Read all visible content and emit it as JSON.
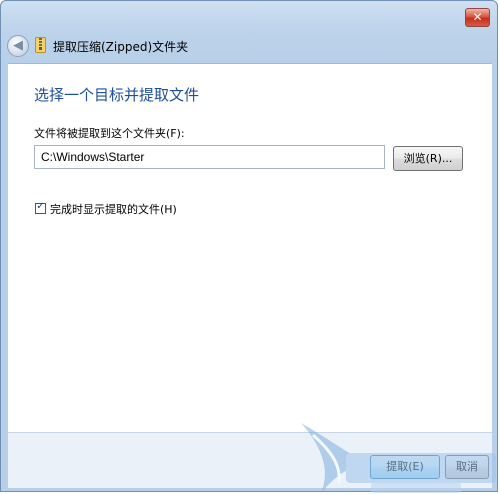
{
  "window": {
    "close_glyph": "✕",
    "title": "提取压缩(Zipped)文件夹",
    "back_glyph": "◀"
  },
  "dialog": {
    "heading": "选择一个目标并提取文件",
    "path_label": "文件将被提取到这个文件夹(F):",
    "path_value": "C:\\Windows\\Starter",
    "browse_label": "浏览(R)...",
    "checkbox_checked": true,
    "checkbox_glyph": "✓",
    "checkbox_label": "完成时显示提取的文件(H)"
  },
  "footer": {
    "extract_label": "提取(E)",
    "cancel_label": "取消"
  },
  "colors": {
    "heading": "#1e4f9a",
    "frame": "#bcd3ea"
  }
}
